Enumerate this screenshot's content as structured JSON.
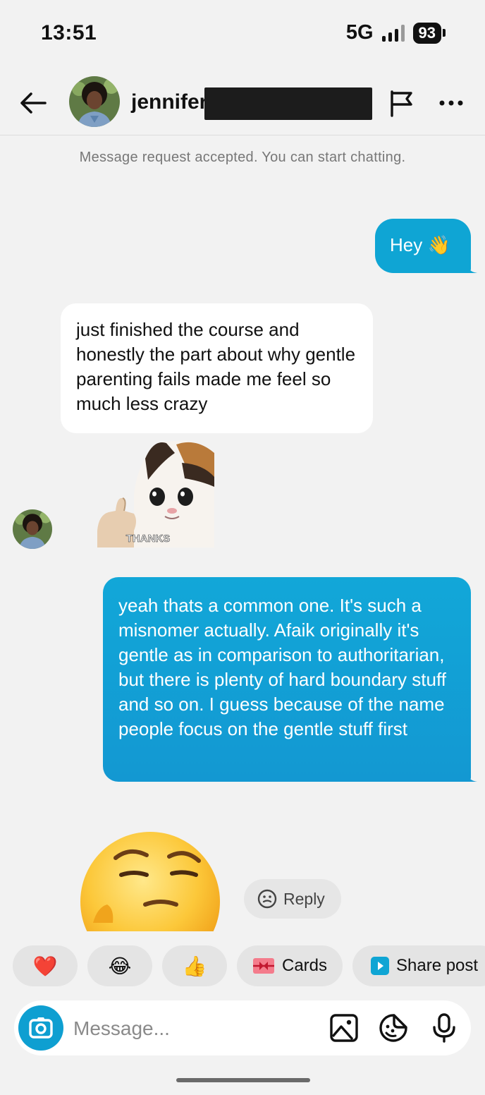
{
  "status_bar": {
    "time": "13:51",
    "network": "5G",
    "battery": "93"
  },
  "header": {
    "contact_name": "jennifer",
    "back_icon": "back-arrow-icon",
    "flag_icon": "flag-icon",
    "more_icon": "more-icon"
  },
  "system_message": "Message request accepted. You can start chatting.",
  "messages": [
    {
      "direction": "outgoing",
      "text": "Hey 👋"
    },
    {
      "direction": "incoming",
      "text": "just finished the course and honestly the part about why gentle parenting fails made me feel so much less crazy"
    },
    {
      "direction": "incoming",
      "type": "sticker",
      "caption": "THANKS"
    },
    {
      "direction": "outgoing",
      "text": "yeah thats a common one. It's such a misnomer actually. Afaik originally it's gentle as in comparison to authoritarian, but there is plenty of hard boundary stuff and so on. I guess because of the name people focus on the gentle stuff first"
    },
    {
      "direction": "incoming",
      "type": "emoji",
      "emoji": "🤔"
    }
  ],
  "reply_chip": {
    "label": "Reply"
  },
  "quick_actions": [
    {
      "label": "",
      "emoji": "❤️"
    },
    {
      "label": "",
      "emoji": "😂"
    },
    {
      "label": "",
      "emoji": "👍"
    },
    {
      "label": "Cards",
      "icon": "cards-icon"
    },
    {
      "label": "Share post",
      "icon": "share-post-icon"
    }
  ],
  "composer": {
    "placeholder": "Message..."
  },
  "colors": {
    "accent": "#0fa5d4",
    "bubble_in": "#ffffff",
    "background": "#f2f2f2",
    "heart": "#e0202a"
  }
}
